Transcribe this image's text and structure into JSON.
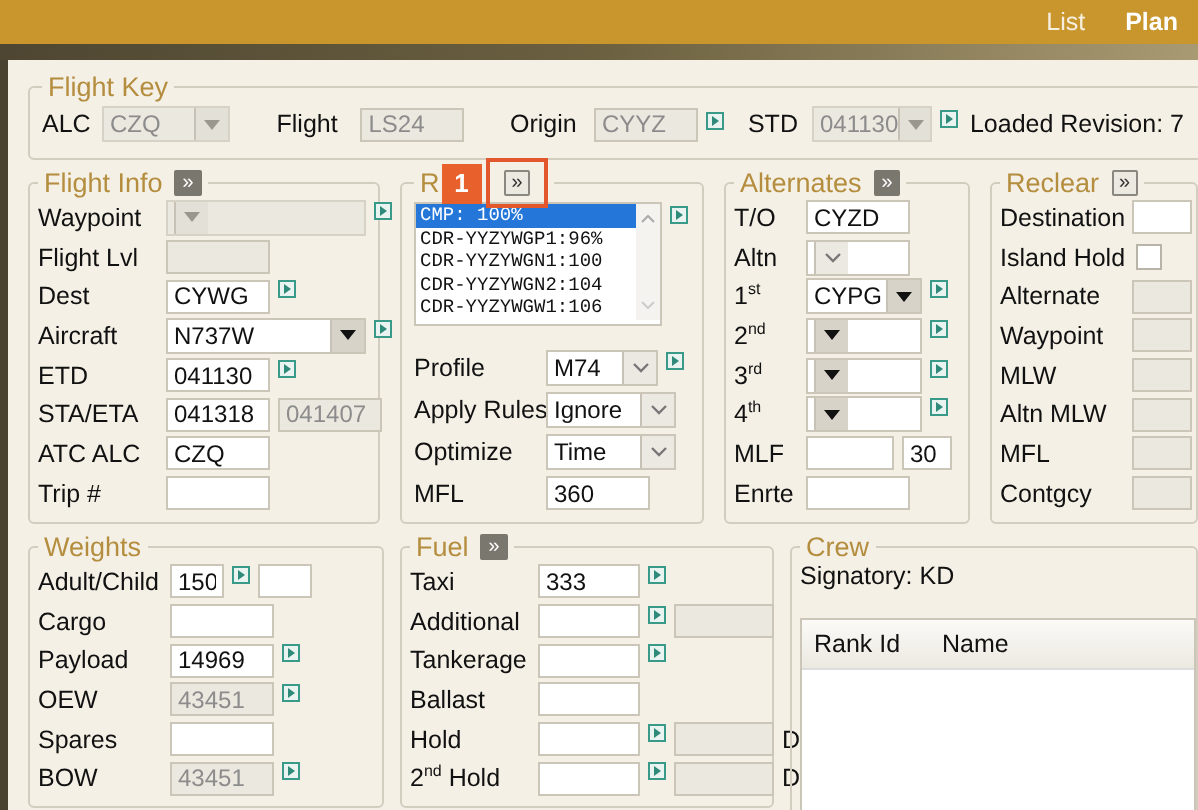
{
  "header": {
    "tabs": [
      {
        "label": "List",
        "selected": false
      },
      {
        "label": "Plan",
        "selected": true
      }
    ]
  },
  "flight_key": {
    "legend": "Flight Key",
    "fields": [
      {
        "label": "ALC",
        "kind": "select",
        "value": "CZQ",
        "disabled": true,
        "link": false
      },
      {
        "label": "Flight",
        "kind": "text",
        "value": "LS24",
        "disabled": true,
        "link": false
      },
      {
        "label": "Origin",
        "kind": "text",
        "value": "CYYZ",
        "disabled": true,
        "link": true
      },
      {
        "label": "STD",
        "kind": "select",
        "value": "041130",
        "disabled": true,
        "link": true
      }
    ],
    "revision": "Loaded Revision: 7"
  },
  "flight_info": {
    "legend": "Flight Info",
    "more": {
      "label": "»",
      "kind": "dark"
    },
    "fields": [
      {
        "label": "Waypoint",
        "kind": "select",
        "disabled": true,
        "link": true
      },
      {
        "label": "Flight Lvl",
        "kind": "text",
        "disabled": true,
        "link": false
      },
      {
        "label": "Dest",
        "kind": "text",
        "value": "CYWG",
        "disabled": false,
        "link": true
      },
      {
        "label": "Aircraft",
        "kind": "select",
        "value": "N737W",
        "disabled": false,
        "link": true
      },
      {
        "label": "ETD",
        "kind": "text",
        "value": "041130",
        "disabled": false,
        "link": true
      },
      {
        "label": "STA/ETA",
        "kind": "text",
        "value": "041318",
        "disabled": false,
        "link": false,
        "extra": {
          "value": "041407",
          "disabled": true
        }
      },
      {
        "label": "ATC ALC",
        "kind": "text",
        "value": "CZQ",
        "disabled": false,
        "link": false
      },
      {
        "label": "Trip #",
        "kind": "text",
        "disabled": false,
        "link": false
      }
    ]
  },
  "route": {
    "legend": "R",
    "badge": "1",
    "more": {
      "label": "»",
      "kind": "light",
      "highlighted": true
    },
    "list": [
      {
        "text": "CMP: 100%",
        "selected": true
      },
      {
        "text": "CDR-YYZYWGP1:96%",
        "selected": false
      },
      {
        "text": "CDR-YYZYWGN1:100",
        "selected": false
      },
      {
        "text": "CDR-YYZYWGN2:104",
        "selected": false
      },
      {
        "text": "CDR-YYZYWGW1:106",
        "selected": false
      }
    ],
    "fields": [
      {
        "label": "Profile",
        "kind": "dropdown",
        "value": "M74",
        "disabled": false,
        "link": true
      },
      {
        "label": "Apply Rules",
        "kind": "dropdown",
        "value": "Ignore",
        "disabled": false,
        "link": false
      },
      {
        "label": "Optimize",
        "kind": "dropdown",
        "value": "Time",
        "disabled": false,
        "link": false
      },
      {
        "label": "MFL",
        "kind": "text",
        "value": "360",
        "disabled": false,
        "link": false
      }
    ]
  },
  "alternates": {
    "legend": "Alternates",
    "more": {
      "label": "»",
      "kind": "dark"
    },
    "fields": [
      {
        "label": "T/O",
        "kind": "text",
        "value": "CYZD",
        "disabled": false,
        "link": false
      },
      {
        "label": "Altn",
        "kind": "dropdown",
        "disabled": false,
        "link": false
      },
      {
        "label": "1$^{st}$",
        "kind": "select",
        "value": "CYPG",
        "disabled": false,
        "link": true
      },
      {
        "label": "2$^{nd}$",
        "kind": "select",
        "disabled": false,
        "link": true
      },
      {
        "label": "3$^{rd}$",
        "kind": "select",
        "disabled": false,
        "link": true
      },
      {
        "label": "4$^{th}$",
        "kind": "select",
        "disabled": false,
        "link": true
      },
      {
        "label": "MLF",
        "kind": "text",
        "disabled": false,
        "link": false,
        "extra": {
          "value": "30",
          "disabled": false
        }
      },
      {
        "label": "Enrte",
        "kind": "text",
        "disabled": false,
        "link": false
      }
    ]
  },
  "reclear": {
    "legend": "Reclear",
    "more": {
      "label": "»",
      "kind": "light"
    },
    "fields": [
      {
        "label": "Destination",
        "kind": "text",
        "disabled": false,
        "link": false
      },
      {
        "label": "Island Hold",
        "kind": "checkbox",
        "checked": false,
        "disabled": false,
        "link": false
      },
      {
        "label": "Alternate",
        "kind": "text",
        "disabled": true,
        "link": false
      },
      {
        "label": "Waypoint",
        "kind": "text",
        "disabled": true,
        "link": false
      },
      {
        "label": "MLW",
        "kind": "text",
        "disabled": true,
        "link": false
      },
      {
        "label": "Altn MLW",
        "kind": "text",
        "disabled": true,
        "link": false
      },
      {
        "label": "MFL",
        "kind": "text",
        "disabled": true,
        "link": false
      },
      {
        "label": "Contgcy",
        "kind": "text",
        "disabled": true,
        "link": false
      }
    ]
  },
  "weights": {
    "legend": "Weights",
    "fields": [
      {
        "label": "Adult/Child",
        "kind": "text",
        "value": "150",
        "disabled": false,
        "link": true,
        "extra": {
          "disabled": false
        }
      },
      {
        "label": "Cargo",
        "kind": "text",
        "disabled": false,
        "link": false
      },
      {
        "label": "Payload",
        "kind": "text",
        "value": "14969",
        "disabled": false,
        "link": true
      },
      {
        "label": "OEW",
        "kind": "text",
        "value": "43451",
        "disabled": true,
        "link": true
      },
      {
        "label": "Spares",
        "kind": "text",
        "disabled": false,
        "link": false
      },
      {
        "label": "BOW",
        "kind": "text",
        "value": "43451",
        "disabled": true,
        "link": true
      }
    ]
  },
  "fuel": {
    "legend": "Fuel",
    "more": {
      "label": "»",
      "kind": "dark"
    },
    "fields": [
      {
        "label": "Taxi",
        "kind": "text",
        "value": "333",
        "disabled": false,
        "link": true
      },
      {
        "label": "Additional",
        "kind": "text",
        "disabled": false,
        "link": true,
        "extra": {
          "disabled": true
        }
      },
      {
        "label": "Tankerage",
        "kind": "text",
        "disabled": false,
        "link": true
      },
      {
        "label": "Ballast",
        "kind": "text",
        "disabled": false,
        "link": false
      },
      {
        "label": "Hold",
        "kind": "text",
        "disabled": false,
        "link": true,
        "extra": {
          "disabled": true
        },
        "suffix": "D"
      },
      {
        "label": "2$^{nd}$ Hold",
        "kind": "text",
        "disabled": false,
        "link": true,
        "extra": {
          "disabled": true
        },
        "suffix": "D"
      }
    ]
  },
  "crew": {
    "legend": "Crew",
    "signatory": "Signatory: KD",
    "columns": [
      "Rank Id",
      "Name"
    ]
  }
}
